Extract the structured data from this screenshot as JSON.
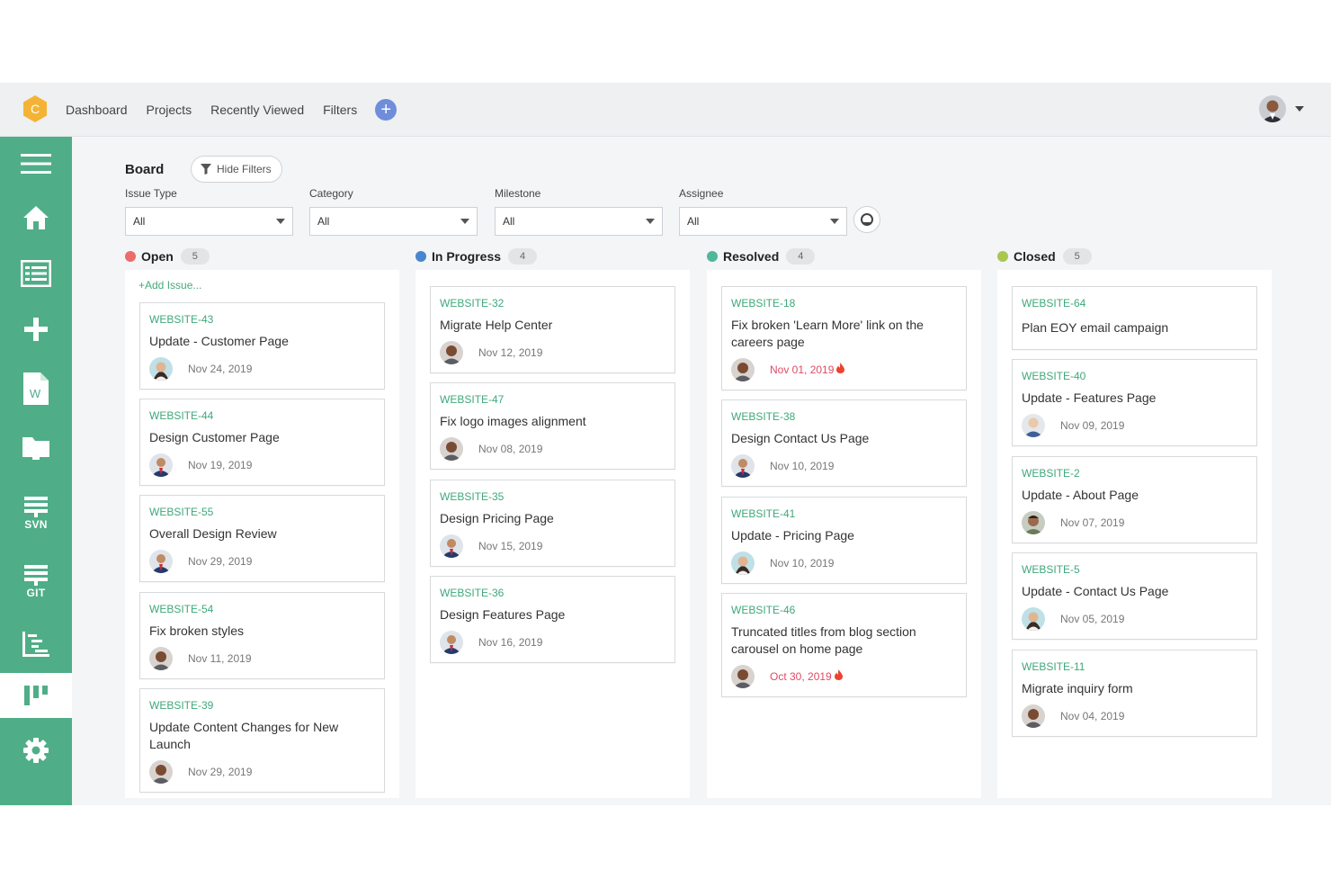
{
  "topbar": {
    "logo_letter": "C",
    "nav": [
      "Dashboard",
      "Projects",
      "Recently Viewed",
      "Filters"
    ],
    "add_symbol": "+"
  },
  "sidebar": {
    "items": [
      {
        "icon": "menu-icon"
      },
      {
        "icon": "home-icon"
      },
      {
        "icon": "list-icon"
      },
      {
        "icon": "plus-icon"
      },
      {
        "icon": "word-document-icon",
        "letter": "W"
      },
      {
        "icon": "folder-icon"
      },
      {
        "icon": "svn-icon",
        "label": "SVN"
      },
      {
        "icon": "git-icon",
        "label": "GIT"
      },
      {
        "icon": "gantt-icon"
      },
      {
        "icon": "board-icon",
        "active": true
      },
      {
        "icon": "settings-icon"
      }
    ]
  },
  "board": {
    "title": "Board",
    "hide_filters": "Hide Filters",
    "filters": [
      {
        "label": "Issue Type",
        "value": "All"
      },
      {
        "label": "Category",
        "value": "All"
      },
      {
        "label": "Milestone",
        "value": "All"
      },
      {
        "label": "Assignee",
        "value": "All"
      }
    ],
    "add_issue": "+Add Issue..."
  },
  "columns": [
    {
      "name": "Open",
      "count": "5",
      "color": "#ec6b6b",
      "cards": [
        {
          "id": "WEBSITE-43",
          "title": "Update - Customer Page",
          "date": "Nov 24, 2019",
          "avatar": "woman"
        },
        {
          "id": "WEBSITE-44",
          "title": "Design Customer Page",
          "date": "Nov 19, 2019",
          "avatar": "suit"
        },
        {
          "id": "WEBSITE-55",
          "title": "Overall Design Review",
          "date": "Nov 29, 2019",
          "avatar": "suit"
        },
        {
          "id": "WEBSITE-54",
          "title": "Fix broken styles",
          "date": "Nov 11, 2019",
          "avatar": "dark"
        },
        {
          "id": "WEBSITE-39",
          "title": "Update Content Changes for New Launch",
          "date": "Nov 29, 2019",
          "avatar": "dark"
        }
      ]
    },
    {
      "name": "In Progress",
      "count": "4",
      "color": "#4a86cf",
      "cards": [
        {
          "id": "WEBSITE-32",
          "title": "Migrate Help Center",
          "date": "Nov 12, 2019",
          "avatar": "dark"
        },
        {
          "id": "WEBSITE-47",
          "title": "Fix logo images alignment",
          "date": "Nov 08, 2019",
          "avatar": "dark"
        },
        {
          "id": "WEBSITE-35",
          "title": "Design Pricing Page",
          "date": "Nov 15, 2019",
          "avatar": "suit"
        },
        {
          "id": "WEBSITE-36",
          "title": "Design Features Page",
          "date": "Nov 16, 2019",
          "avatar": "suit"
        }
      ]
    },
    {
      "name": "Resolved",
      "count": "4",
      "color": "#4fb89a",
      "cards": [
        {
          "id": "WEBSITE-18",
          "title": "Fix broken 'Learn More' link on the careers page",
          "date": "Nov 01, 2019",
          "avatar": "dark",
          "overdue": true
        },
        {
          "id": "WEBSITE-38",
          "title": "Design Contact Us Page",
          "date": "Nov 10, 2019",
          "avatar": "suit"
        },
        {
          "id": "WEBSITE-41",
          "title": "Update - Pricing Page",
          "date": "Nov 10, 2019",
          "avatar": "woman"
        },
        {
          "id": "WEBSITE-46",
          "title": "Truncated titles from blog section carousel on home page",
          "date": "Oct 30, 2019",
          "avatar": "dark",
          "overdue": true
        }
      ]
    },
    {
      "name": "Closed",
      "count": "5",
      "color": "#a9c750",
      "cards": [
        {
          "id": "WEBSITE-64",
          "title": "Plan EOY email campaign"
        },
        {
          "id": "WEBSITE-40",
          "title": "Update - Features Page",
          "date": "Nov 09, 2019",
          "avatar": "light"
        },
        {
          "id": "WEBSITE-2",
          "title": "Update - About Page",
          "date": "Nov 07, 2019",
          "avatar": "man"
        },
        {
          "id": "WEBSITE-5",
          "title": "Update - Contact Us Page",
          "date": "Nov 05, 2019",
          "avatar": "woman"
        },
        {
          "id": "WEBSITE-11",
          "title": "Migrate inquiry form",
          "date": "Nov 04, 2019",
          "avatar": "dark"
        }
      ]
    }
  ]
}
